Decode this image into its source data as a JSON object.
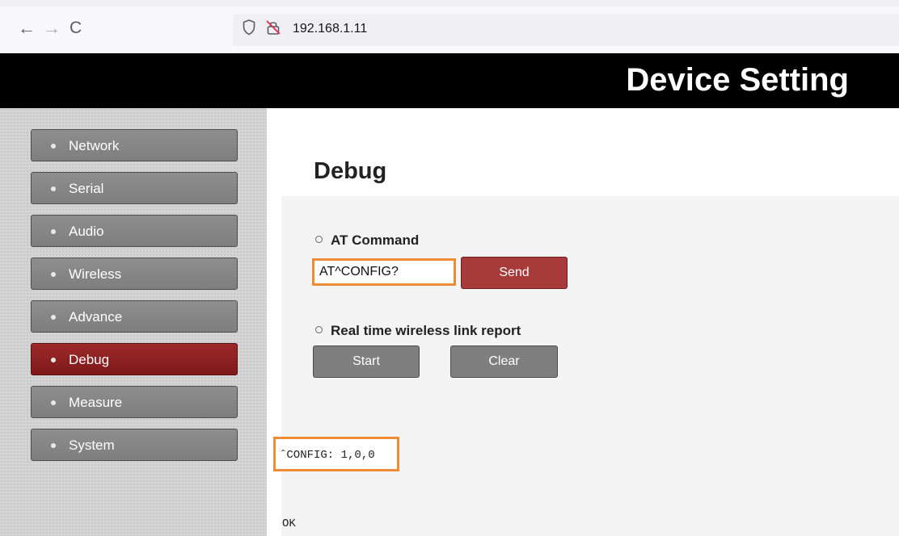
{
  "browser": {
    "url": "192.168.1.11",
    "back_icon": "←",
    "forward_icon": "→",
    "reload_icon": "C"
  },
  "header": {
    "title": "Device Setting"
  },
  "sidebar": {
    "items": [
      {
        "label": "Network",
        "active": false
      },
      {
        "label": "Serial",
        "active": false
      },
      {
        "label": "Audio",
        "active": false
      },
      {
        "label": "Wireless",
        "active": false
      },
      {
        "label": "Advance",
        "active": false
      },
      {
        "label": "Debug",
        "active": true
      },
      {
        "label": "Measure",
        "active": false
      },
      {
        "label": "System",
        "active": false
      }
    ]
  },
  "main": {
    "heading": "Debug",
    "at_command": {
      "title": "AT Command",
      "input_value": "AT^CONFIG?",
      "send_label": "Send"
    },
    "link_report": {
      "title": "Real time wireless link report",
      "start_label": "Start",
      "clear_label": "Clear"
    },
    "output": {
      "line1": "ˆCONFIG: 1,0,0",
      "line2": "OK"
    }
  },
  "colors": {
    "header_bg": "#000000",
    "active_menu": "#8b2020",
    "send_button": "#a93a3a",
    "highlight_border": "#ef8b35"
  }
}
